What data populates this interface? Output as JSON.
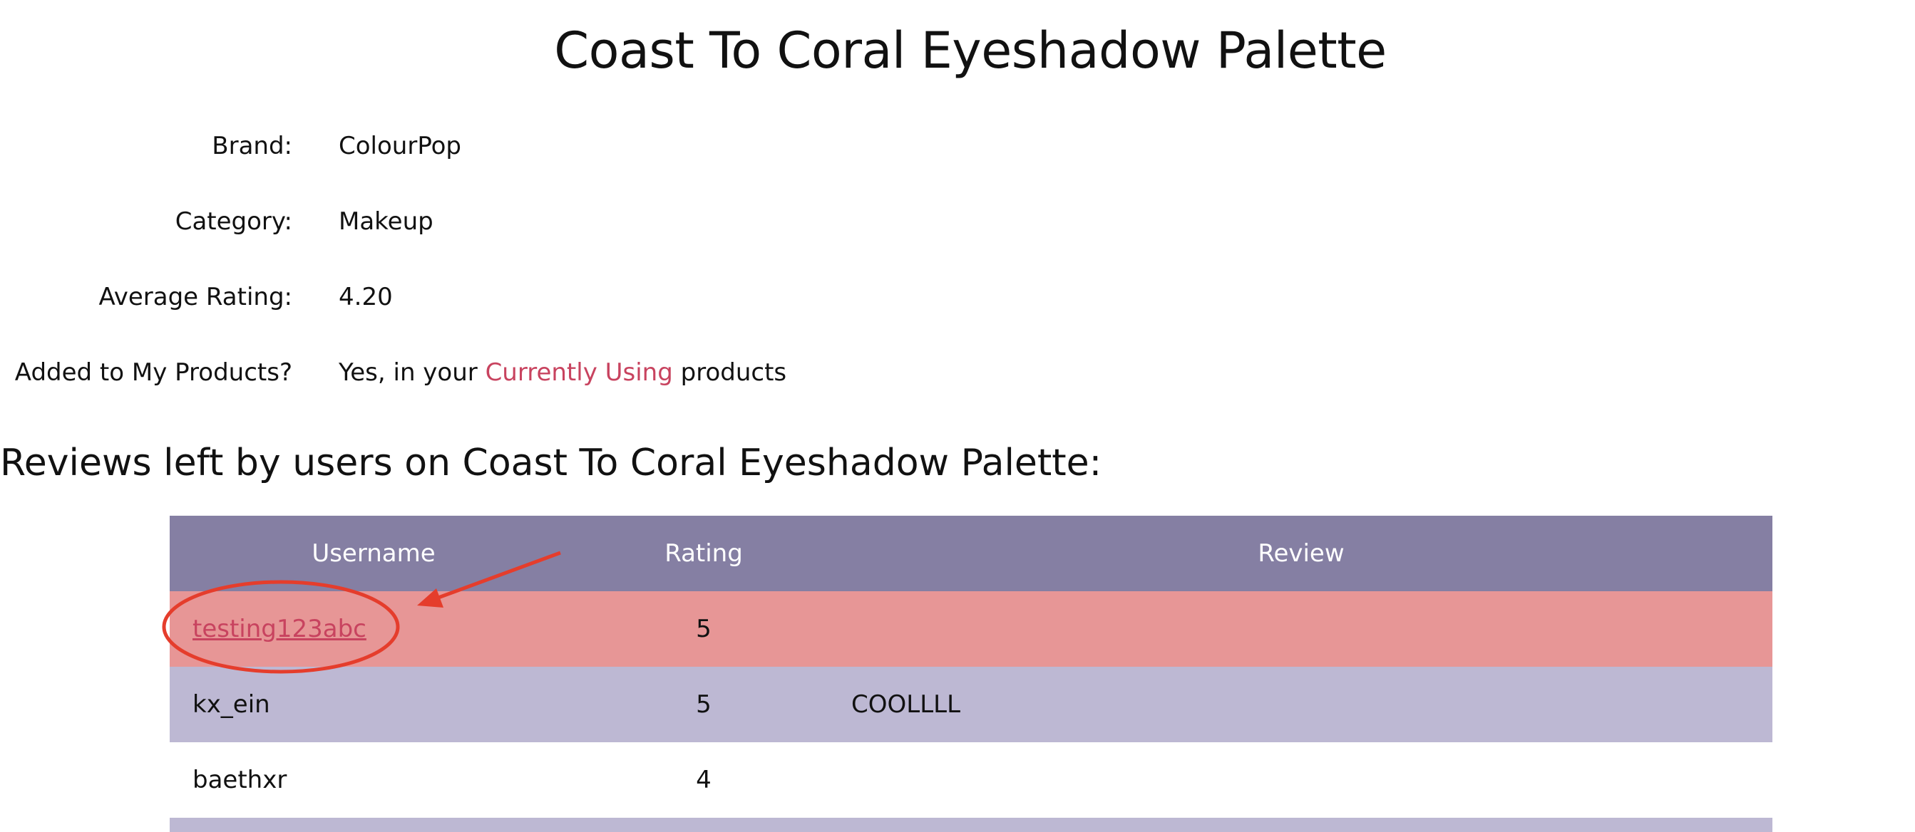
{
  "product": {
    "title": "Coast To Coral Eyeshadow Palette"
  },
  "info": {
    "brand_label": "Brand:",
    "brand_value": "ColourPop",
    "category_label": "Category:",
    "category_value": "Makeup",
    "avg_rating_label": "Average Rating:",
    "avg_rating_value": "4.20",
    "added_label": "Added to My Products?",
    "added_prefix": "Yes, in your ",
    "added_link": "Currently Using",
    "added_suffix": " products"
  },
  "reviews": {
    "heading": "Reviews left by users on Coast To Coral Eyeshadow Palette:",
    "columns": [
      "Username",
      "Rating",
      "Review"
    ],
    "rows": [
      {
        "username": "testing123abc",
        "rating": "5",
        "review": ""
      },
      {
        "username": "kx_ein",
        "rating": "5",
        "review": "COOLLLL"
      },
      {
        "username": "baethxr",
        "rating": "4",
        "review": ""
      }
    ]
  },
  "colors": {
    "header_bg": "#857fa3",
    "highlight_row": "#e79696",
    "alt_row": "#bdb8d3",
    "accent": "#c8435f",
    "annotation": "#e53d2c"
  }
}
